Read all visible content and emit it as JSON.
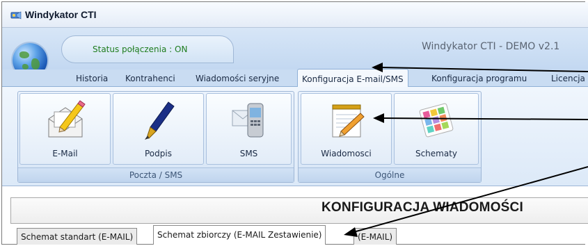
{
  "window": {
    "title": "Windykator CTI"
  },
  "status": {
    "text": "Status połączenia : ON",
    "version": "Windykator CTI  - DEMO v2.1"
  },
  "tabs": [
    {
      "label": "Historia"
    },
    {
      "label": "Kontrahenci"
    },
    {
      "label": "Wiadomości seryjne"
    },
    {
      "label": "Konfiguracja E-mail/SMS"
    },
    {
      "label": "Konfiguracja programu"
    },
    {
      "label": "Licencja"
    }
  ],
  "ribbon": {
    "groups": [
      {
        "label": "Poczta / SMS",
        "buttons": [
          {
            "label": "E-Mail",
            "icon": "email-envelope-icon"
          },
          {
            "label": "Podpis",
            "icon": "fountain-pen-icon"
          },
          {
            "label": "SMS",
            "icon": "sms-phone-icon"
          }
        ]
      },
      {
        "label": "Ogólne",
        "buttons": [
          {
            "label": "Wiadomosci",
            "icon": "notepad-pencil-icon"
          },
          {
            "label": "Schematy",
            "icon": "color-cards-icon"
          }
        ]
      }
    ]
  },
  "section": {
    "title": "KONFIGURACJA WIADOMOŚCI"
  },
  "bottom_tabs": [
    {
      "label": "Schemat standart (E-MAIL)"
    },
    {
      "label": "Schemat zbiorczy (E-MAIL Zestawienie)"
    },
    {
      "label": "(E-MAIL)"
    }
  ],
  "colors": {
    "accent": "#c3d8f1",
    "status_on": "#1f7d1f",
    "arrow": "#000000"
  }
}
